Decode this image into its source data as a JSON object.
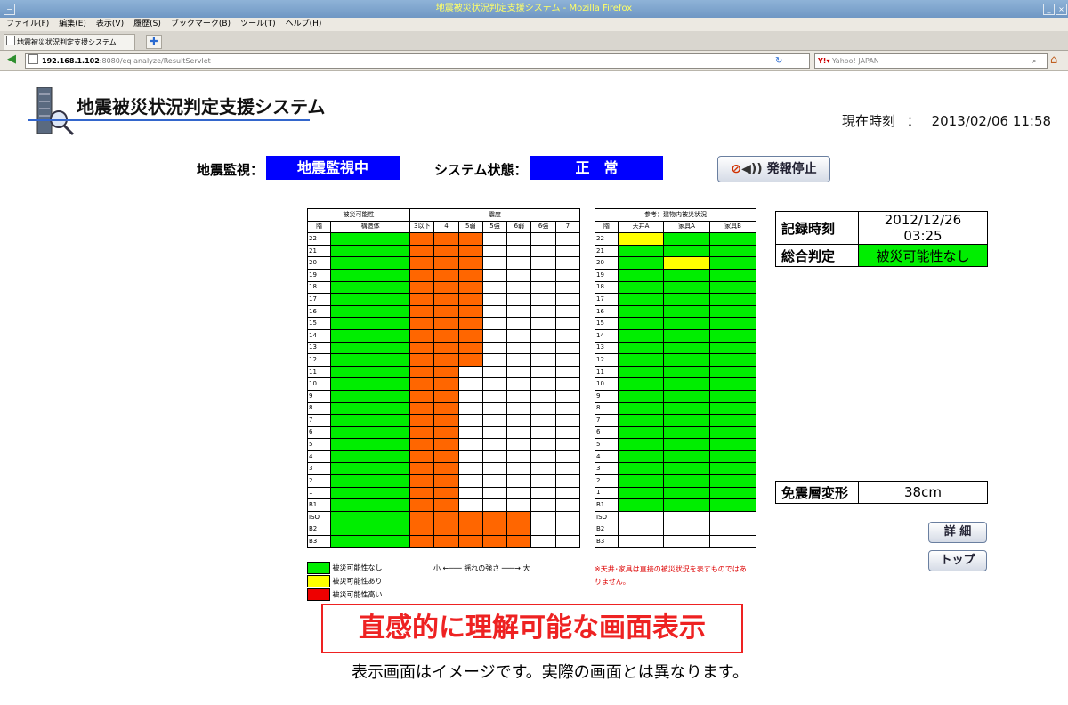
{
  "window": {
    "title": "地震被災状況判定支援システム - Mozilla Firefox"
  },
  "menubar": [
    "ファイル(F)",
    "編集(E)",
    "表示(V)",
    "履歴(S)",
    "ブックマーク(B)",
    "ツール(T)",
    "ヘルプ(H)"
  ],
  "tab": {
    "label": "地震被災状況判定支援システム"
  },
  "nav": {
    "url_host": "192.168.1.102",
    "url_rest": ":8080/eq analyze/ResultServlet",
    "search_placeholder": "Yahoo! JAPAN"
  },
  "page": {
    "logo_title": "地震被災状況判定支援システム",
    "clock_label": "現在時刻",
    "clock_sep": "：",
    "clock_value": "2013/02/06 11:58",
    "monitor_label": "地震監視：",
    "monitor_value": "地震監視中",
    "system_label": "システム状態：",
    "system_value": "正　常",
    "alarm_stop_label": "発報停止",
    "record_time_label": "記録時刻",
    "record_time_value": "2012/12/26 03:25",
    "overall_label": "総合判定",
    "overall_value": "被災可能性なし",
    "isolation_label": "免震層変形",
    "isolation_value": "38cm",
    "detail_button": "詳 細",
    "top_button": "トップ",
    "legend": [
      "被災可能性なし",
      "被災可能性あり",
      "被災可能性高い"
    ],
    "intensity_note_small": "小",
    "intensity_note_text": "揺れの強さ",
    "intensity_note_large": "大",
    "reference_note": "※天井･家具は直接の被災状況を表すものではありません。",
    "banner": "直感的に理解可能な画面表示",
    "caption": "表示画面はイメージです。実際の画面とは異なります。"
  },
  "colors": {
    "safe": "#00ee00",
    "caution": "#ffff00",
    "danger": "#ee0000",
    "shake": "#ff6600",
    "status_blue": "#0000ff"
  },
  "main_table": {
    "header_group_damage": "被災可能性",
    "header_group_intensity": "震度",
    "col_floor": "階",
    "col_structure": "構造体",
    "intensity_cols": [
      "3以下",
      "4",
      "5弱",
      "5強",
      "6弱",
      "6強",
      "7"
    ],
    "floors": [
      "22",
      "21",
      "20",
      "19",
      "18",
      "17",
      "16",
      "15",
      "14",
      "13",
      "12",
      "11",
      "10",
      "9",
      "8",
      "7",
      "6",
      "5",
      "4",
      "3",
      "2",
      "1",
      "B1",
      "ISO",
      "B2",
      "B3"
    ],
    "intensity_levels": [
      3,
      3,
      3,
      3,
      3,
      3,
      3,
      3,
      3,
      3,
      3,
      2,
      2,
      2,
      2,
      2,
      2,
      2,
      2,
      2,
      2,
      2,
      2,
      5,
      5,
      5
    ]
  },
  "ref_table": {
    "header_group": "参考：建物内被災状況",
    "col_floor": "階",
    "cols": [
      "天井A",
      "家具A",
      "家具B"
    ],
    "cells": [
      [
        "y",
        "g",
        "g"
      ],
      [
        "g",
        "g",
        "g"
      ],
      [
        "g",
        "y",
        "g"
      ],
      [
        "g",
        "g",
        "g"
      ],
      [
        "g",
        "g",
        "g"
      ],
      [
        "g",
        "g",
        "g"
      ],
      [
        "g",
        "g",
        "g"
      ],
      [
        "g",
        "g",
        "g"
      ],
      [
        "g",
        "g",
        "g"
      ],
      [
        "g",
        "g",
        "g"
      ],
      [
        "g",
        "g",
        "g"
      ],
      [
        "g",
        "g",
        "g"
      ],
      [
        "g",
        "g",
        "g"
      ],
      [
        "g",
        "g",
        "g"
      ],
      [
        "g",
        "g",
        "g"
      ],
      [
        "g",
        "g",
        "g"
      ],
      [
        "g",
        "g",
        "g"
      ],
      [
        "g",
        "g",
        "g"
      ],
      [
        "g",
        "g",
        "g"
      ],
      [
        "g",
        "g",
        "g"
      ],
      [
        "g",
        "g",
        "g"
      ],
      [
        "g",
        "g",
        "g"
      ],
      [
        "g",
        "g",
        "g"
      ],
      [
        "w",
        "w",
        "w"
      ],
      [
        "w",
        "w",
        "w"
      ],
      [
        "w",
        "w",
        "w"
      ]
    ]
  }
}
